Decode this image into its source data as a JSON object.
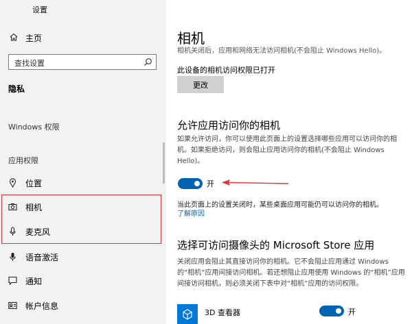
{
  "sidebar": {
    "app_title": "设置",
    "home_label": "主页",
    "search_placeholder": "查找设置",
    "section_privacy": "隐私",
    "section_windows": "Windows 权限",
    "section_app": "应用权限",
    "items": [
      {
        "label": "位置",
        "icon": "location-pin-icon"
      },
      {
        "label": "相机",
        "icon": "camera-icon"
      },
      {
        "label": "麦克风",
        "icon": "microphone-icon"
      },
      {
        "label": "语音激活",
        "icon": "voice-activation-icon"
      },
      {
        "label": "通知",
        "icon": "notification-icon"
      },
      {
        "label": "帐户信息",
        "icon": "account-info-icon"
      }
    ]
  },
  "main": {
    "title": "相机",
    "cut_text": "相机关闭后，应用和网络无法访问相机(不会阻止 Windows Hello)。",
    "access_status": "此设备的相机访问权限已打开",
    "change_button": "更改",
    "allow_heading": "允许应用访问你的相机",
    "allow_desc": "如果允许访问，你可以使用此页面上的设置选择哪些应用可以访问你的相机。如果拒绝访问，则会阻止应用访问你的相机(不会阻止 Windows Hello)。",
    "toggle_label": "开",
    "toggle_on": true,
    "note_text": "当此页面上的设置关闭时，某些桌面应用可能仍可以访问你的相机。",
    "learn_more": "了解原因",
    "store_heading": "选择可访问摄像头的 Microsoft Store 应用",
    "store_desc": "关闭应用会阻止其直接访问你的相机。它不会阻止应用通过 Windows 的“相机”应用间接访问相机。若还想阻止应用使用 Windows 的“相机”应用间接访问相机，则必须关闭下表中对“相机”应用的访问权限。",
    "apps": [
      {
        "name": "3D 查看器",
        "toggle_label": "开",
        "on": true
      }
    ]
  },
  "colors": {
    "accent": "#0063b1",
    "highlight": "#e0333a",
    "link": "#0067c0"
  }
}
